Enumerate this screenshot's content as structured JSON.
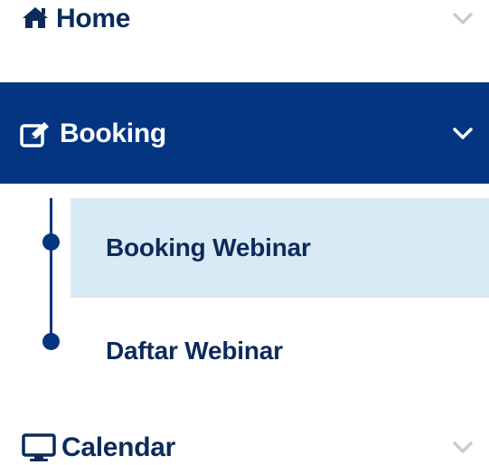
{
  "menu": {
    "home": {
      "label": "Home",
      "icon": "home-icon",
      "expanded": false
    },
    "booking": {
      "label": "Booking",
      "icon": "edit-square-icon",
      "expanded": true,
      "items": [
        {
          "label": "Booking Webinar",
          "active": true
        },
        {
          "label": "Daftar Webinar",
          "active": false
        }
      ]
    },
    "calendar": {
      "label": "Calendar",
      "icon": "desktop-monitor-icon",
      "expanded": false
    }
  },
  "colors": {
    "primary": "#033580",
    "text": "#0d2a5c",
    "active_bg": "#d8eaf5",
    "chevron_muted": "#c7ccd4"
  }
}
